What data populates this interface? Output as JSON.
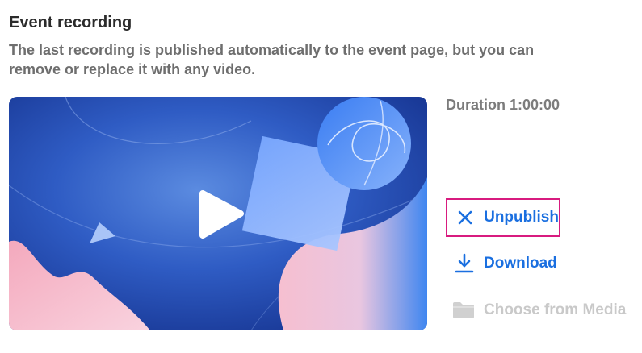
{
  "section": {
    "title": "Event recording",
    "description": "The last recording is published automatically to the event page, but you can remove or replace it with any video."
  },
  "recording": {
    "duration_text": "Duration 1:00:00"
  },
  "actions": {
    "unpublish_label": "Unpublish",
    "download_label": "Download",
    "choose_label": "Choose from Media"
  },
  "colors": {
    "accent": "#1a6fe0",
    "focus_border": "#d81b7f",
    "disabled": "#c9c9c9"
  },
  "icons": {
    "play": "play-icon",
    "unpublish": "close-icon",
    "download": "download-icon",
    "choose": "folder-icon"
  }
}
